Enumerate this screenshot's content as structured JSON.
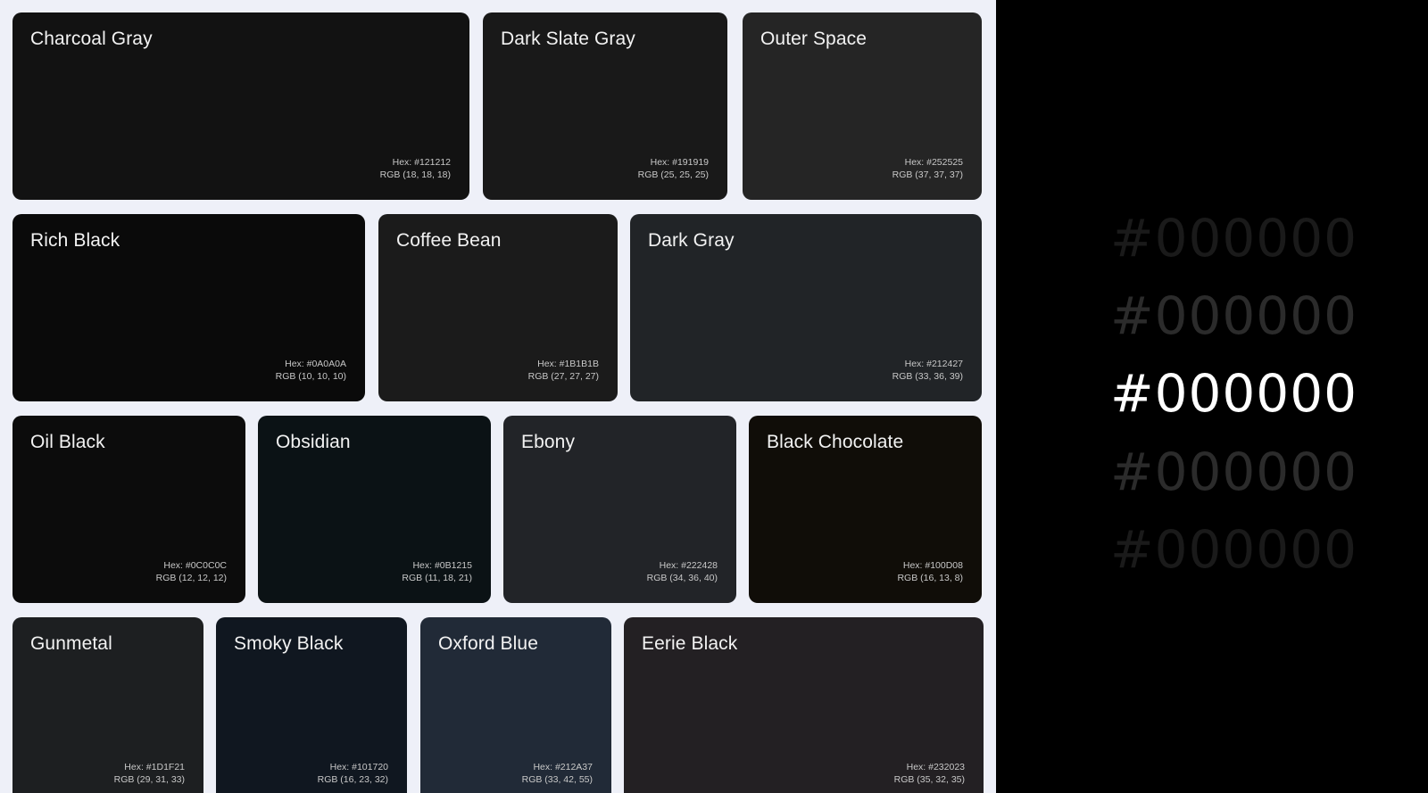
{
  "swatch_rows": [
    [
      {
        "name": "Charcoal Gray",
        "hex_label": "Hex: #121212",
        "rgb_label": "RGB (18, 18, 18)",
        "color": "#121212"
      },
      {
        "name": "Dark Slate Gray",
        "hex_label": "Hex: #191919",
        "rgb_label": "RGB (25, 25, 25)",
        "color": "#191919"
      },
      {
        "name": "Outer Space",
        "hex_label": "Hex: #252525",
        "rgb_label": "RGB (37, 37, 37)",
        "color": "#252525"
      }
    ],
    [
      {
        "name": "Rich Black",
        "hex_label": "Hex: #0A0A0A",
        "rgb_label": "RGB (10, 10, 10)",
        "color": "#0A0A0A"
      },
      {
        "name": "Coffee Bean",
        "hex_label": "Hex: #1B1B1B",
        "rgb_label": "RGB (27, 27, 27)",
        "color": "#1B1B1B"
      },
      {
        "name": "Dark Gray",
        "hex_label": "Hex: #212427",
        "rgb_label": "RGB (33, 36, 39)",
        "color": "#212427"
      }
    ],
    [
      {
        "name": "Oil Black",
        "hex_label": "Hex: #0C0C0C",
        "rgb_label": "RGB (12, 12, 12)",
        "color": "#0C0C0C"
      },
      {
        "name": "Obsidian",
        "hex_label": "Hex: #0B1215",
        "rgb_label": "RGB (11, 18, 21)",
        "color": "#0B1215"
      },
      {
        "name": "Ebony",
        "hex_label": "Hex: #222428",
        "rgb_label": "RGB (34, 36, 40)",
        "color": "#222428"
      },
      {
        "name": "Black Chocolate",
        "hex_label": "Hex: #100D08",
        "rgb_label": "RGB (16, 13, 8)",
        "color": "#100D08"
      }
    ],
    [
      {
        "name": "Gunmetal",
        "hex_label": "Hex: #1D1F21",
        "rgb_label": "RGB (29, 31, 33)",
        "color": "#1D1F21"
      },
      {
        "name": "Smoky Black",
        "hex_label": "Hex: #101720",
        "rgb_label": "RGB (16, 23, 32)",
        "color": "#101720"
      },
      {
        "name": "Oxford Blue",
        "hex_label": "Hex: #212A37",
        "rgb_label": "RGB (33, 42, 55)",
        "color": "#212A37"
      },
      {
        "name": "Eerie Black",
        "hex_label": "Hex: #232023",
        "rgb_label": "RGB (35, 32, 35)",
        "color": "#232023"
      }
    ]
  ],
  "hex_list": {
    "items": [
      {
        "text": "#000000",
        "color": "#1a1a1a"
      },
      {
        "text": "#000000",
        "color": "#2b2b2b"
      },
      {
        "text": "#000000",
        "color": "#ffffff"
      },
      {
        "text": "#000000",
        "color": "#2b2b2b"
      },
      {
        "text": "#000000",
        "color": "#1a1a1a"
      }
    ]
  }
}
